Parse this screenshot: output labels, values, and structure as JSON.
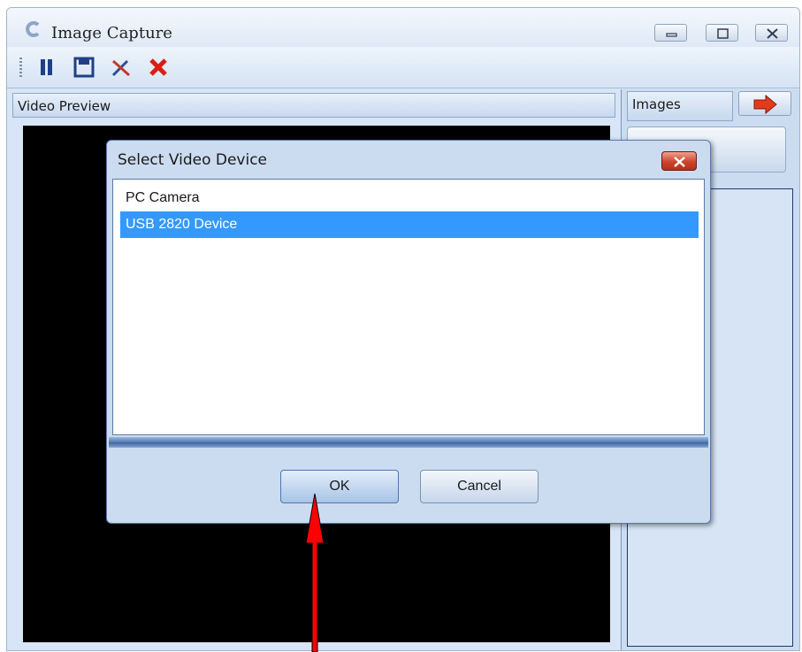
{
  "window": {
    "title": "Image Capture"
  },
  "toolbar": {
    "icons": [
      "pause-icon",
      "save-icon",
      "settings-icon",
      "close-x-icon"
    ]
  },
  "preview": {
    "title": "Video Preview"
  },
  "images_panel": {
    "title": "Images"
  },
  "dialog": {
    "title": "Select Video Device",
    "devices": [
      "PC Camera",
      "USB 2820 Device"
    ],
    "selected": "USB 2820 Device",
    "ok_label": "OK",
    "cancel_label": "Cancel"
  },
  "colors": {
    "selection": "#3399ff",
    "annotation_arrow": "#ff0000",
    "preview_bg": "#000000"
  }
}
